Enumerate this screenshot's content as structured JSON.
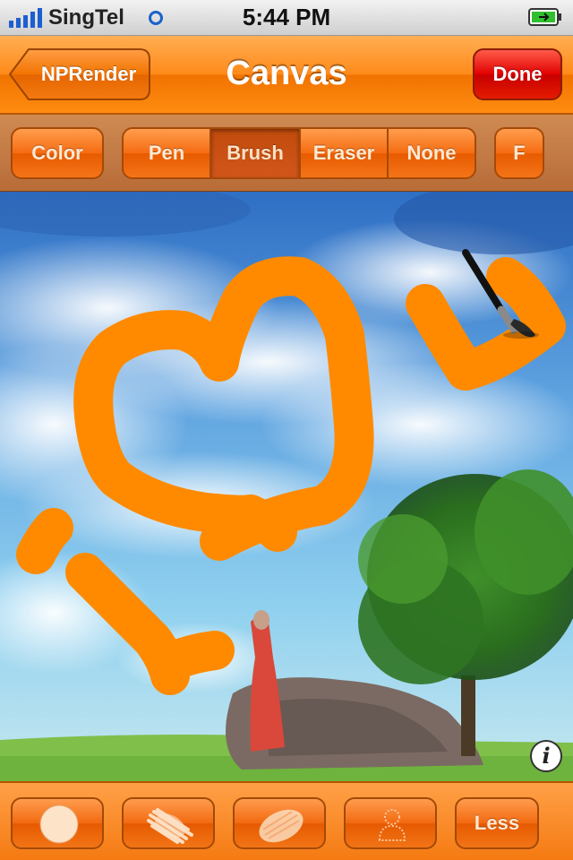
{
  "status_bar": {
    "carrier": "SingTel",
    "time": "5:44 PM"
  },
  "nav": {
    "back_label": "NPRender",
    "title": "Canvas",
    "done_label": "Done"
  },
  "toolbar": {
    "color_label": "Color",
    "tools": [
      {
        "label": "Pen",
        "selected": false
      },
      {
        "label": "Brush",
        "selected": true
      },
      {
        "label": "Eraser",
        "selected": false
      },
      {
        "label": "None",
        "selected": false
      }
    ],
    "f_label": "F"
  },
  "bottom_bar": {
    "buttons": [
      {
        "icon": "round-brush-icon"
      },
      {
        "icon": "rough-brush-icon"
      },
      {
        "icon": "soft-brush-icon"
      },
      {
        "icon": "person-stamp-icon"
      }
    ],
    "less_label": "Less"
  },
  "info_glyph": "i",
  "colors": {
    "accent": "#ff8a1a",
    "stroke": "#ff8a00",
    "done": "#e00000"
  }
}
